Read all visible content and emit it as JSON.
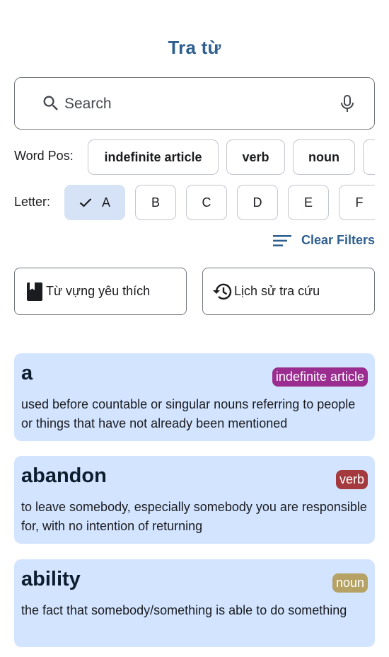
{
  "header": {
    "title": "Tra từ"
  },
  "search": {
    "placeholder": "Search"
  },
  "pos_filter": {
    "label": "Word Pos:",
    "chips": [
      "indefinite article",
      "verb",
      "noun",
      ""
    ]
  },
  "letter_filter": {
    "label": "Letter:",
    "letters": [
      "A",
      "B",
      "C",
      "D",
      "E",
      "F"
    ],
    "selected": "A"
  },
  "clear_filters": {
    "label": "Clear Filters"
  },
  "actions": {
    "favorites_label": "Từ vựng yêu thích",
    "history_label": "Lịch sử tra cứu"
  },
  "entries": [
    {
      "word": "a",
      "pos": "indefinite article",
      "pos_color": "#9a2d8f",
      "definition": "used before countable or singular nouns referring to people or things that have not already been mentioned"
    },
    {
      "word": "abandon",
      "pos": "verb",
      "pos_color": "#a53a3e",
      "definition": "to leave somebody, especially somebody you are responsible for, with no intention of returning"
    },
    {
      "word": "ability",
      "pos": "noun",
      "pos_color": "#b5a264",
      "definition": "the fact that somebody/something is able to do something"
    }
  ],
  "colors": {
    "primary": "#2f5f8f",
    "card_bg": "#d2e4ff",
    "selected_chip_bg": "#d6e3f7"
  }
}
